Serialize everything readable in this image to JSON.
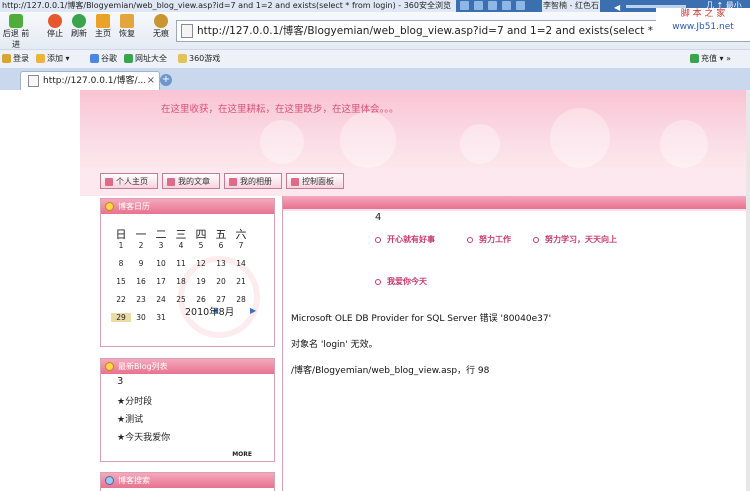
{
  "window": {
    "title": "http://127.0.0.1/博客/Blogyemian/web_blog_view.asp?id=7 and 1=2 and exists(select * from login) - 360安全浏览"
  },
  "media_player": {
    "song": "李智楠 - 红色石",
    "window_controls": "几 ↑ 最小"
  },
  "toolbar": {
    "buttons": [
      {
        "label": "后退 前进",
        "icon": "back-forward-icon"
      },
      {
        "label": "停止",
        "icon": "stop-icon"
      },
      {
        "label": "刷新",
        "icon": "refresh-icon"
      },
      {
        "label": "主页",
        "icon": "home-icon"
      },
      {
        "label": "恢复",
        "icon": "restore-icon"
      },
      {
        "label": "无痕",
        "icon": "incognito-icon"
      }
    ],
    "address": "http://127.0.0.1/博客/Blogyemian/web_blog_view.asp?id=7 and 1=2 and exists(select * from login)",
    "watermark": "脚 本 之 家",
    "watermark_url": "www.Jb51.net"
  },
  "favorites": {
    "items": [
      "登录",
      "添加",
      "谷歌",
      "网址大全",
      "360游戏"
    ],
    "recharge": "充值"
  },
  "tabs": [
    {
      "title": "http://127.0.0.1/博客/..."
    }
  ],
  "banner": {
    "slogan": "在这里收获，在这里耕耘，在这里跌步，在这里体会。。。"
  },
  "nav": {
    "items": [
      "个人主页",
      "我的文章",
      "我的相册",
      "控制面板"
    ]
  },
  "calendar": {
    "title": "博客日历",
    "weekdays": [
      "日",
      "一",
      "二",
      "三",
      "四",
      "五",
      "六"
    ],
    "weeks": [
      [
        "1",
        "2",
        "3",
        "4",
        "5",
        "6",
        "7"
      ],
      [
        "8",
        "9",
        "10",
        "11",
        "12",
        "13",
        "14"
      ],
      [
        "15",
        "16",
        "17",
        "18",
        "19",
        "20",
        "21"
      ],
      [
        "22",
        "23",
        "24",
        "25",
        "26",
        "27",
        "28"
      ],
      [
        "29",
        "30",
        "31"
      ]
    ],
    "today": "29",
    "month": "2010年8月",
    "prev": "◀",
    "next": "▶"
  },
  "latest_blogs": {
    "title": "最新Blog列表",
    "count": "3",
    "items": [
      "★分时段",
      "★测试",
      "★今天我爱你"
    ],
    "more": "MORE"
  },
  "search_box": {
    "title": "博客搜索"
  },
  "main": {
    "number": "4",
    "moods": [
      "开心就有好事",
      "努力工作",
      "努力学习，天天向上",
      "我爱你今天"
    ],
    "error_line1": "Microsoft OLE DB Provider for SQL Server  错误 '80040e37'",
    "error_line2": "对象名 'login' 无效。",
    "error_line3": "/博客/Blogyemian/web_blog_view.asp，行 98"
  }
}
